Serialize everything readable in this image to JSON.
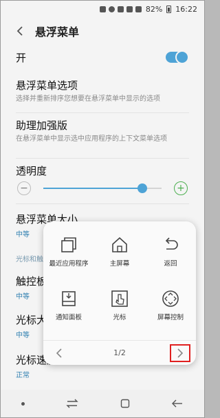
{
  "status_bar": {
    "battery": "82%",
    "time": "16:22"
  },
  "header": {
    "title": "悬浮菜单"
  },
  "settings": {
    "toggle_label": "开",
    "options": {
      "title": "悬浮菜单选项",
      "subtitle": "选择并重新排序您想要在悬浮菜单中显示的选项"
    },
    "assist_plus": {
      "title": "助理加强版",
      "subtitle": "在悬浮菜单中显示选中应用程序的上下文菜单选项"
    },
    "transparency": {
      "title": "透明度",
      "level": 0.84
    },
    "menu_size": {
      "title": "悬浮菜单大小",
      "value": "中等"
    },
    "cursor_section": {
      "title": "光标和触控板"
    },
    "touchpad_size": {
      "title": "触控板大小",
      "value": "中等"
    },
    "cursor_size": {
      "title": "光标大小",
      "value": "中等"
    },
    "cursor_speed": {
      "title": "光标速度",
      "value": "正常"
    }
  },
  "floating_menu": {
    "items": [
      {
        "label": "最近应用程序",
        "icon": "recent-apps-icon"
      },
      {
        "label": "主屏幕",
        "icon": "home-icon"
      },
      {
        "label": "返回",
        "icon": "back-icon"
      },
      {
        "label": "通知面板",
        "icon": "notification-panel-icon"
      },
      {
        "label": "光标",
        "icon": "cursor-icon"
      },
      {
        "label": "屏幕控制",
        "icon": "screen-control-icon"
      }
    ],
    "page_indicator": "1/2"
  },
  "colors": {
    "accent": "#4ea3d6",
    "value_text": "#2f7fb0",
    "highlight": "#e02020"
  }
}
